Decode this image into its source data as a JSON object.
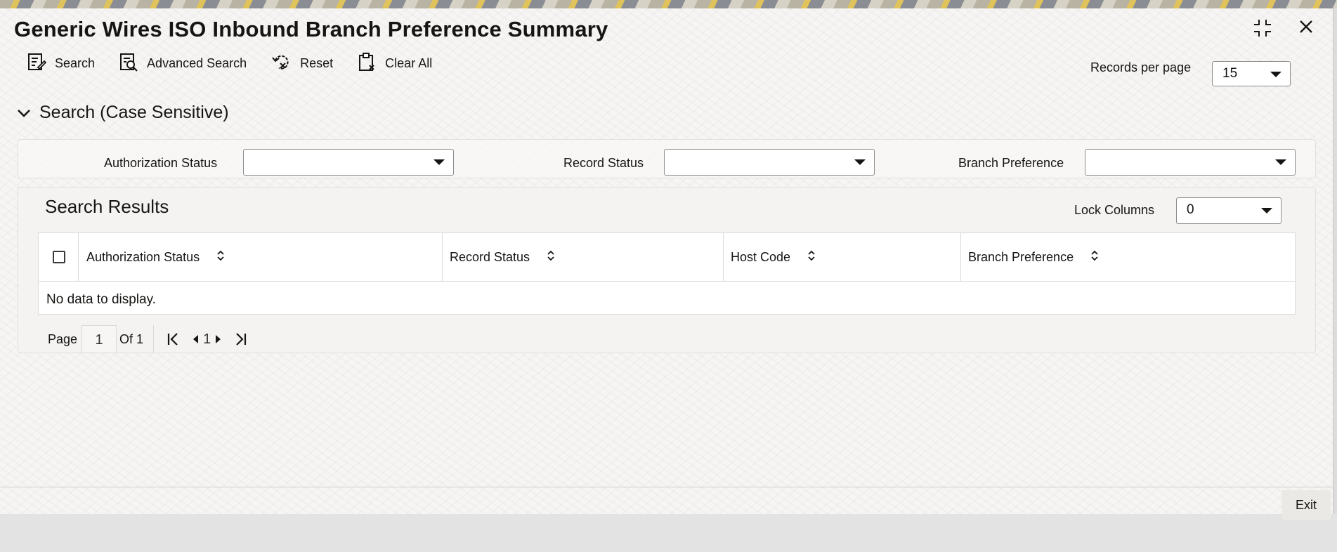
{
  "window": {
    "title": "Generic Wires ISO Inbound Branch Preference Summary"
  },
  "toolbar": {
    "search_label": "Search",
    "advanced_search_label": "Advanced Search",
    "reset_label": "Reset",
    "clear_all_label": "Clear All"
  },
  "records_per_page": {
    "label": "Records per page",
    "value": "15"
  },
  "search_section": {
    "title": "Search (Case Sensitive)",
    "fields": [
      {
        "label": "Authorization Status",
        "value": ""
      },
      {
        "label": "Record Status",
        "value": ""
      },
      {
        "label": "Branch Preference",
        "value": ""
      }
    ]
  },
  "results": {
    "title": "Search Results",
    "lock_columns_label": "Lock Columns",
    "lock_columns_value": "0",
    "columns": [
      "Authorization Status",
      "Record Status",
      "Host Code",
      "Branch Preference"
    ],
    "empty_message": "No data to display."
  },
  "pagination": {
    "page_label": "Page",
    "current_page": "1",
    "of_label": "Of 1",
    "page_indicator": "1"
  },
  "footer": {
    "exit_label": "Exit"
  },
  "icons": {
    "maximize": "maximize-icon",
    "close": "close-icon",
    "search": "search-icon",
    "advanced_search": "advanced-search-icon",
    "reset": "reset-icon",
    "clear_all": "clear-all-icon",
    "chevron": "chevron-down-icon",
    "sort": "sort-icon"
  }
}
